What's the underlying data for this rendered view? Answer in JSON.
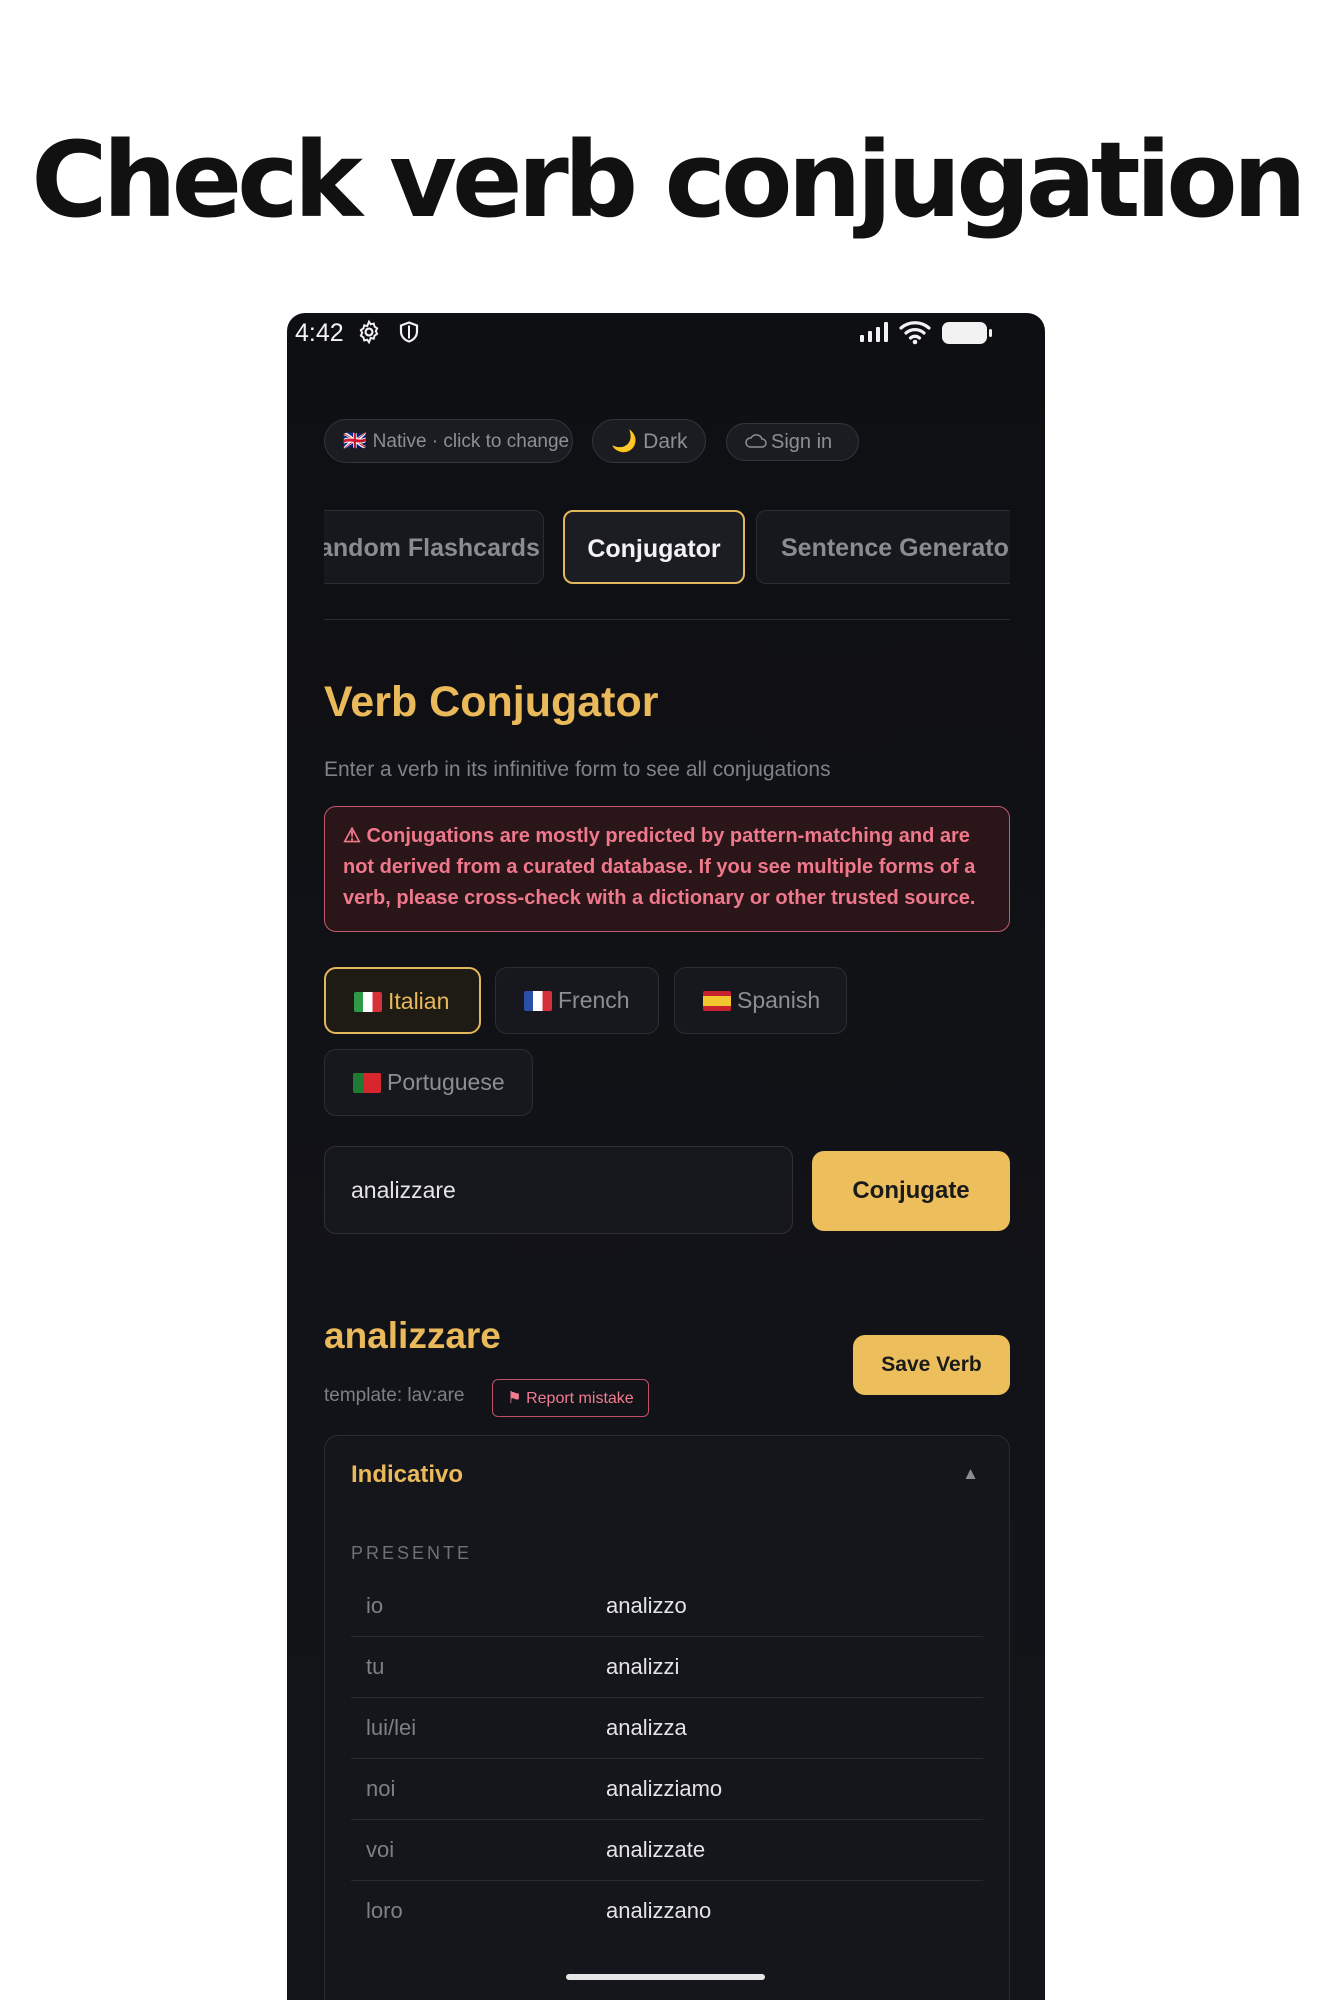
{
  "headline": "Check verb conjugation",
  "status_bar": {
    "time": "4:42"
  },
  "top_pills": {
    "native": {
      "flag": "🇬🇧",
      "label": "Native · click to change"
    },
    "theme": {
      "icon": "🌙",
      "label": "Dark"
    },
    "sign_in": {
      "icon": "cloud-icon",
      "label": "Sign in"
    }
  },
  "tabs": [
    {
      "label": "andom Flashcards"
    },
    {
      "label": "Conjugator",
      "active": true
    },
    {
      "label": "Sentence Generator"
    }
  ],
  "conjugator": {
    "title": "Verb Conjugator",
    "subtitle": "Enter a verb in its infinitive form to see all conjugations",
    "warning": "⚠ Conjugations are mostly predicted by pattern-matching and are not derived from a curated database. If you see multiple forms of a verb, please cross-check with a dictionary or other trusted source.",
    "languages": [
      {
        "label": "Italian",
        "selected": true
      },
      {
        "label": "French"
      },
      {
        "label": "Spanish"
      },
      {
        "label": "Portuguese"
      }
    ],
    "input_value": "analizzare",
    "conjugate_label": "Conjugate"
  },
  "result": {
    "verb": "analizzare",
    "template": "template: lav:are",
    "report_label": "⚑ Report mistake",
    "save_label": "Save Verb",
    "mood": "Indicativo",
    "toggle": "▲",
    "tense": "PRESENTE",
    "rows": [
      {
        "pronoun": "io",
        "form": "analizzo"
      },
      {
        "pronoun": "tu",
        "form": "analizzi"
      },
      {
        "pronoun": "lui/lei",
        "form": "analizza"
      },
      {
        "pronoun": "noi",
        "form": "analizziamo"
      },
      {
        "pronoun": "voi",
        "form": "analizzate"
      },
      {
        "pronoun": "loro",
        "form": "analizzano"
      }
    ]
  },
  "colors": {
    "accent": "#EAB95A",
    "warning": "#F0788B",
    "background": "#101114"
  }
}
